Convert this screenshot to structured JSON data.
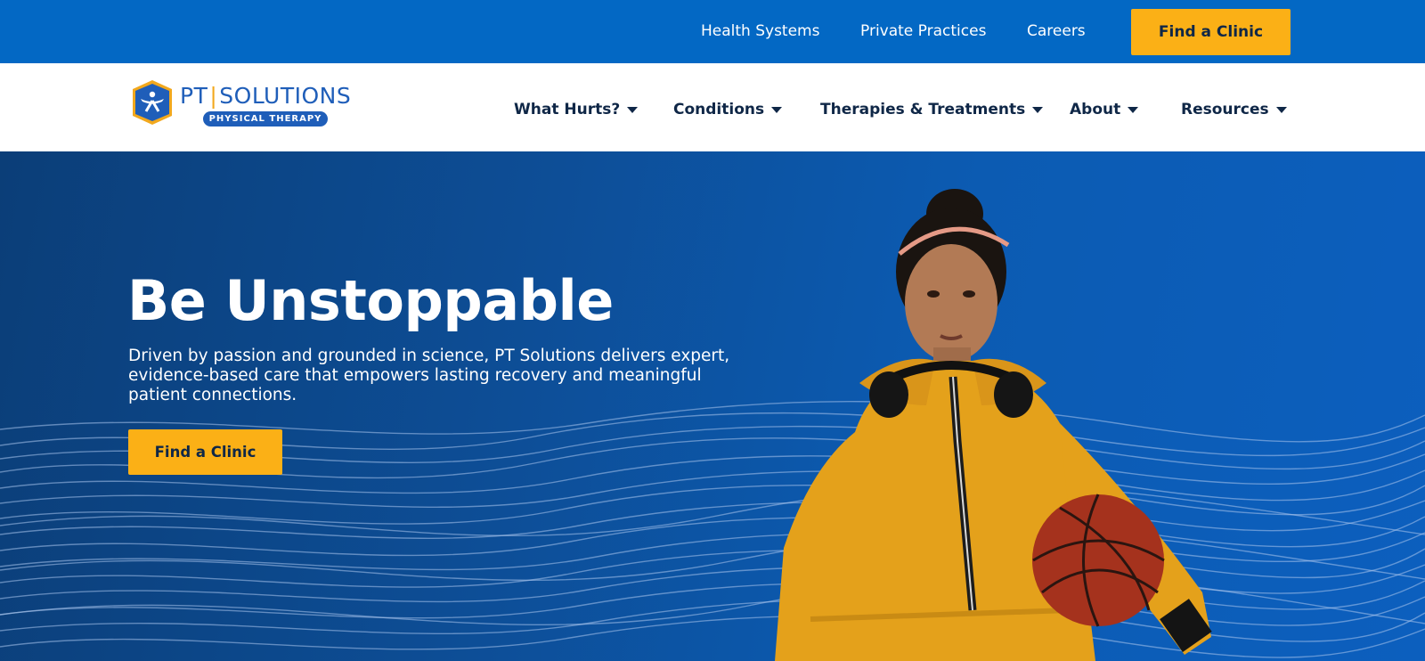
{
  "utility_nav": {
    "links": [
      {
        "label": "Health Systems"
      },
      {
        "label": "Private Practices"
      },
      {
        "label": "Careers"
      }
    ],
    "cta_label": "Find a Clinic"
  },
  "brand": {
    "name_left": "PT",
    "name_right": "SOLUTIONS",
    "tagline": "PHYSICAL THERAPY"
  },
  "main_nav": {
    "items": [
      {
        "label": "What Hurts?"
      },
      {
        "label": "Conditions"
      },
      {
        "label": "Therapies & Treatments"
      },
      {
        "label": "About"
      },
      {
        "label": "Resources"
      }
    ]
  },
  "hero": {
    "title": "Be Unstoppable",
    "description": "Driven by passion and grounded in science, PT Solutions delivers expert, evidence-based care that empowers lasting recovery and meaningful patient connections.",
    "cta_label": "Find a Clinic"
  },
  "colors": {
    "utility_bar": "#0368c4",
    "accent_yellow": "#fbb016",
    "navy_text": "#0f2747",
    "brand_blue": "#1f5eb9",
    "hero_blue": "#0c5bb2"
  }
}
